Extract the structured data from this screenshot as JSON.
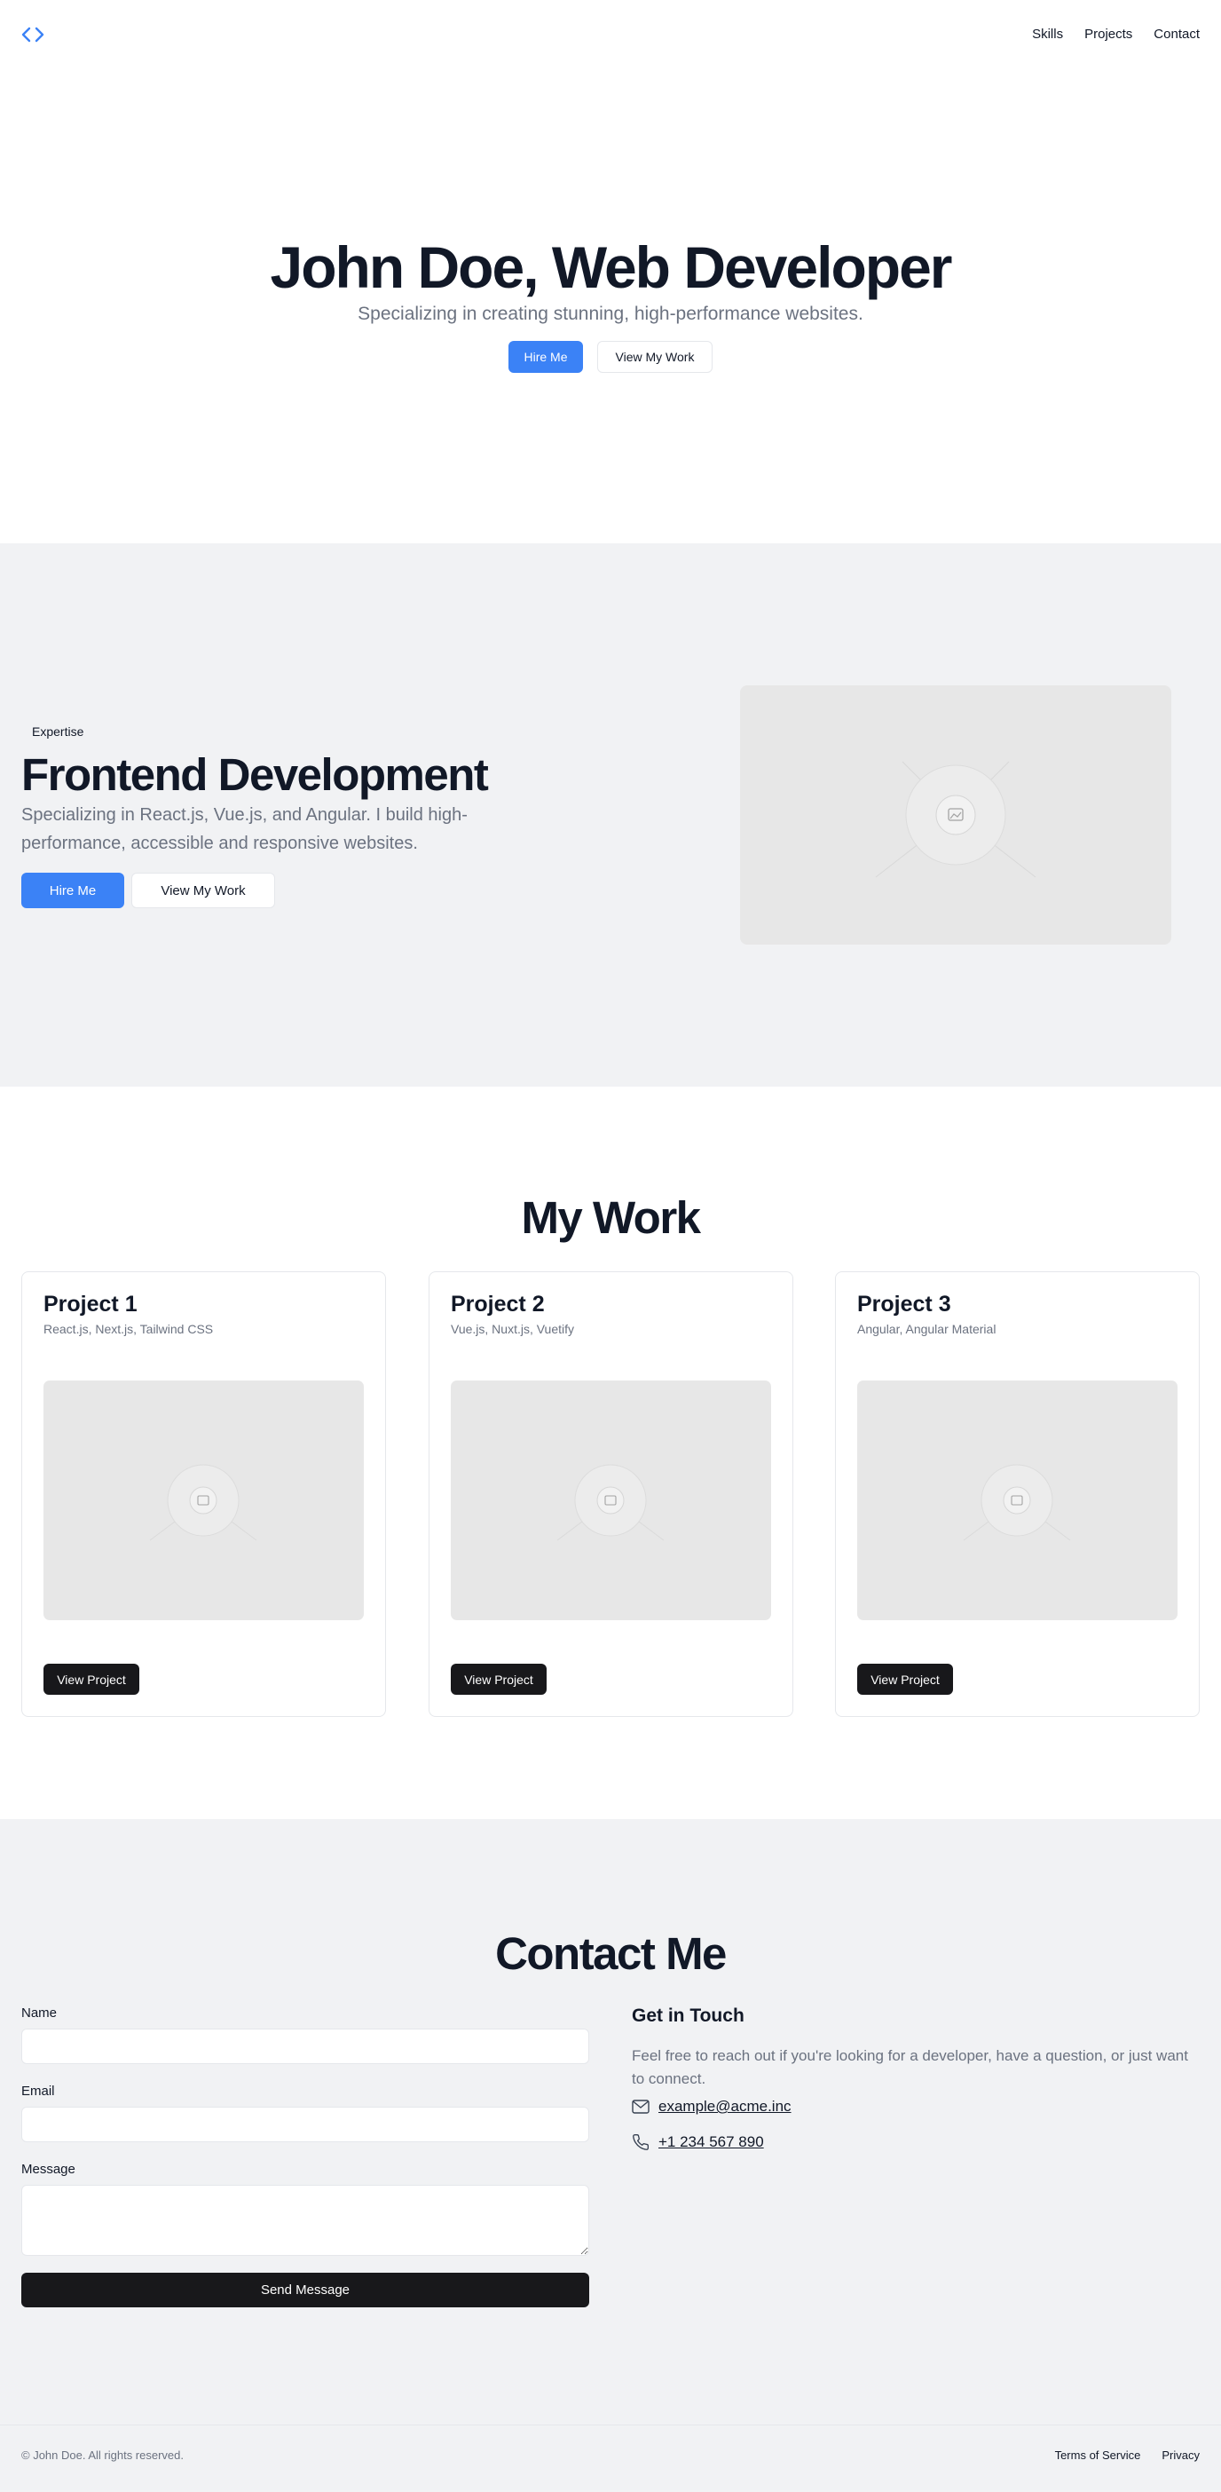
{
  "header": {
    "logo_icon": "code-brackets-icon",
    "nav": [
      "Skills",
      "Projects",
      "Contact"
    ]
  },
  "hero": {
    "title": "John Doe, Web Developer",
    "subtitle": "Specializing in creating stunning, high-performance websites.",
    "primary_label": "Hire Me",
    "secondary_label": "View My Work"
  },
  "expertise": {
    "tag": "Expertise",
    "title": "Frontend Development",
    "description": "Specializing in React.js, Vue.js, and Angular. I build high-performance, accessible and responsive websites.",
    "primary_label": "Hire Me",
    "secondary_label": "View My Work",
    "image_icon": "image-placeholder-icon"
  },
  "work": {
    "title": "My Work",
    "projects": [
      {
        "title": "Project 1",
        "tech": "React.js, Next.js, Tailwind CSS",
        "button": "View Project"
      },
      {
        "title": "Project 2",
        "tech": "Vue.js, Nuxt.js, Vuetify",
        "button": "View Project"
      },
      {
        "title": "Project 3",
        "tech": "Angular, Angular Material",
        "button": "View Project"
      }
    ]
  },
  "contact": {
    "title": "Contact Me",
    "form": {
      "name_label": "Name",
      "name_value": "",
      "email_label": "Email",
      "email_value": "",
      "message_label": "Message",
      "message_value": "",
      "submit_label": "Send Message"
    },
    "info": {
      "heading": "Get in Touch",
      "description": "Feel free to reach out if you're looking for a developer, have a question, or just want to connect.",
      "email": "example@acme.inc",
      "email_icon": "mail-icon",
      "phone": "+1 234 567 890",
      "phone_icon": "phone-icon"
    }
  },
  "footer": {
    "copyright": "© John Doe. All rights reserved.",
    "links": [
      "Terms of Service",
      "Privacy"
    ]
  },
  "colors": {
    "accent": "#3b82f6",
    "dark": "#18181b",
    "muted_bg": "#f1f2f4",
    "heading": "#111827",
    "muted_text": "#6b7280"
  }
}
